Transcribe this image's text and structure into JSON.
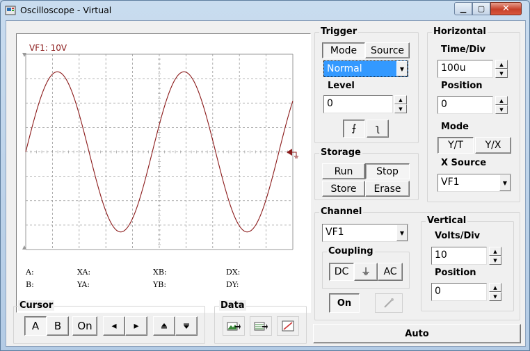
{
  "window": {
    "title": "Oscilloscope - Virtual",
    "min_glyph": "▁",
    "max_glyph": "▢",
    "close_glyph": "✕"
  },
  "scope": {
    "channel_label": "VF1: 10V",
    "trace_color": "#8b1a1a",
    "grid_color": "#9a9a9a",
    "readouts": {
      "a": "A:",
      "b": "B:",
      "xa": "XA:",
      "ya": "YA:",
      "xb": "XB:",
      "yb": "YB:",
      "dx": "DX:",
      "dy": "DY:"
    }
  },
  "trigger": {
    "group_label": "Trigger",
    "mode_label": "Mode",
    "source_label": "Source",
    "mode_value": "Normal",
    "level_label": "Level",
    "level_value": "0",
    "rising_glyph": "⨍",
    "falling_glyph": "ʅ"
  },
  "storage": {
    "group_label": "Storage",
    "run": "Run",
    "stop": "Stop",
    "store": "Store",
    "erase": "Erase"
  },
  "horizontal": {
    "group_label": "Horizontal",
    "time_div_label": "Time/Div",
    "time_div_value": "100u",
    "position_label": "Position",
    "position_value": "0",
    "mode_label": "Mode",
    "yt": "Y/T",
    "yx": "Y/X",
    "xsource_label": "X Source",
    "xsource_value": "VF1"
  },
  "channel": {
    "group_label": "Channel",
    "value": "VF1",
    "coupling_label": "Coupling",
    "dc": "DC",
    "gnd_glyph": "⏚",
    "ac": "AC",
    "on": "On"
  },
  "vertical": {
    "group_label": "Vertical",
    "volts_div_label": "Volts/Div",
    "volts_div_value": "10",
    "position_label": "Position",
    "position_value": "0"
  },
  "cursor": {
    "group_label": "Cursor",
    "a": "A",
    "b": "B",
    "on": "On",
    "left_glyph": "◂",
    "right_glyph": "▸",
    "up_glyph": "⬍",
    "down_glyph": "⬍"
  },
  "data": {
    "group_label": "Data"
  },
  "auto": "Auto",
  "colors": {
    "selection": "#3399ff",
    "trace": "#8b1a1a"
  }
}
